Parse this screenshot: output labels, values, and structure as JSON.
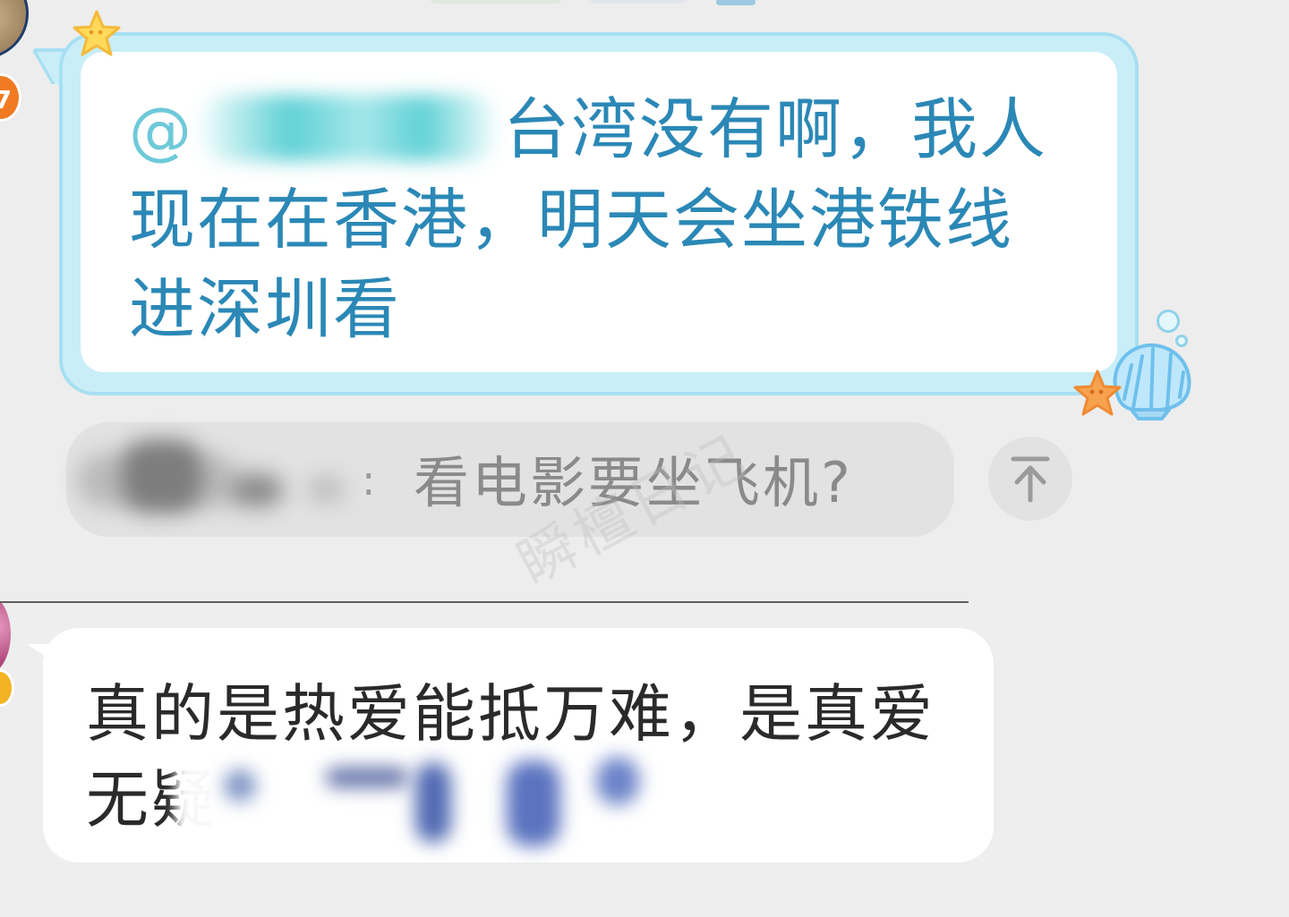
{
  "message_1": {
    "mention_prefix": "@",
    "text": "台湾没有啊，我人现在在香港，明天会坐港铁线进深圳看"
  },
  "reply_quote": {
    "separator": ":",
    "text": "看电影要坐飞机?"
  },
  "scroll_top_button": {
    "icon": "arrow-up-to-top-icon"
  },
  "watermark": {
    "text": "瞬檀日记"
  },
  "message_2": {
    "text": "真的是热爱能抵万难，是真爱无疑"
  },
  "theme": {
    "bubble_text_color": "#2b88b6",
    "bubble_border_color": "#a7dff2",
    "level_badge_color": "#f07a22",
    "badge_color": "#f3b322"
  }
}
